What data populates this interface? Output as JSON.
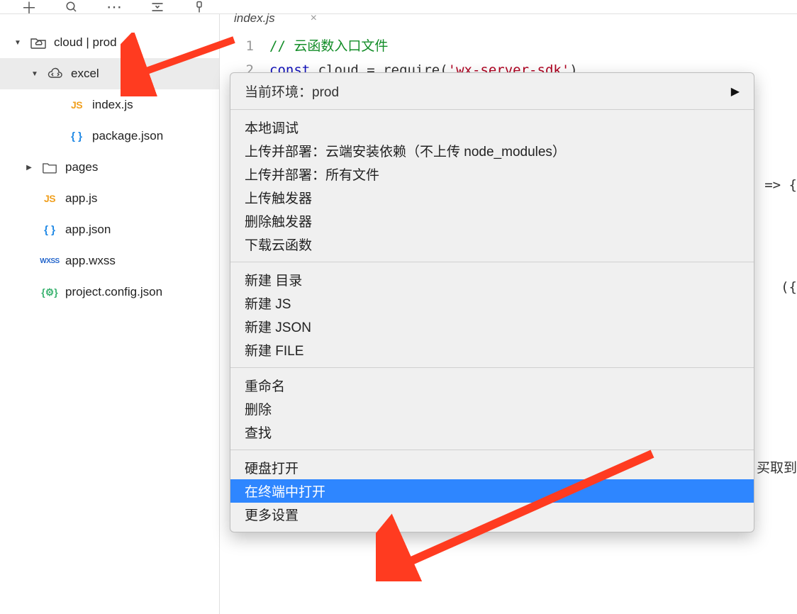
{
  "toolbar": {
    "icons": [
      "plus",
      "search",
      "ellipsis",
      "lines",
      "filter"
    ]
  },
  "tree": {
    "root": {
      "label": "cloud | prod"
    },
    "excel": {
      "label": "excel"
    },
    "index_js": {
      "label": "index.js"
    },
    "package_json": {
      "label": "package.json"
    },
    "pages": {
      "label": "pages"
    },
    "app_js": {
      "label": "app.js"
    },
    "app_json": {
      "label": "app.json"
    },
    "app_wxss": {
      "label": "app.wxss"
    },
    "project_config": {
      "label": "project.config.json"
    }
  },
  "tab": {
    "active": "index.js",
    "close": "×"
  },
  "code": {
    "linenos": [
      "1",
      "2"
    ],
    "line1_comment": "// 云函数入口文件",
    "line2_const": "const ",
    "line2_var": "cloud = require(",
    "line2_string": "'wx-server-sdk'",
    "line2_end": ")"
  },
  "peek": {
    "arrow": "=> {",
    "paren": "({",
    "cn": "买取到"
  },
  "context_menu": {
    "header_label": "当前环境：",
    "header_value": "prod",
    "group1": [
      "本地调试",
      "上传并部署：云端安装依赖（不上传 node_modules）",
      "上传并部署：所有文件",
      "上传触发器",
      "删除触发器",
      "下载云函数"
    ],
    "group2": [
      "新建 目录",
      "新建 JS",
      "新建 JSON",
      "新建 FILE"
    ],
    "group3": [
      "重命名",
      "删除",
      "查找"
    ],
    "group4": [
      "硬盘打开",
      "在终端中打开",
      "更多设置"
    ],
    "highlighted_index": [
      3,
      1
    ]
  }
}
